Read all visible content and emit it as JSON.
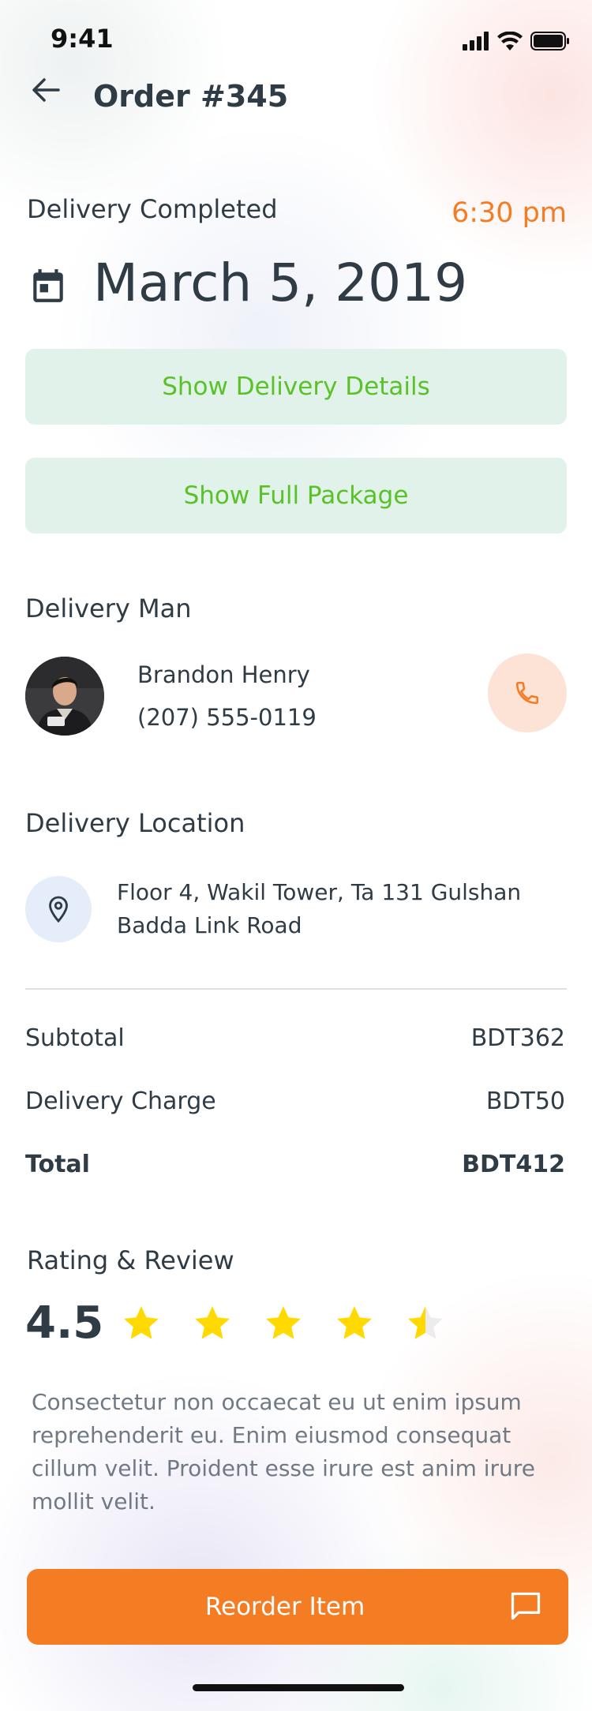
{
  "status_bar": {
    "time": "9:41"
  },
  "header": {
    "back_icon": "arrow-left-icon",
    "title": "Order #345"
  },
  "delivery": {
    "status": "Delivery Completed",
    "time": "6:30 pm",
    "date": "March 5, 2019",
    "details_button": "Show  Delivery Details",
    "package_button": "Show Full Package"
  },
  "delivery_man": {
    "section_title": "Delivery Man",
    "name": "Brandon Henry",
    "phone": "(207) 555-0119",
    "call_icon": "phone-icon"
  },
  "location": {
    "section_title": "Delivery Location",
    "address_line1": "Floor 4, Wakil Tower, Ta 131 Gulshan",
    "address_line2": "Badda Link Road",
    "icon": "location-pin-icon"
  },
  "summary": {
    "subtotal_label": "Subtotal",
    "subtotal_value": "BDT362",
    "delivery_label": "Delivery Charge",
    "delivery_value": "BDT50",
    "total_label": "Total",
    "total_value": "BDT412"
  },
  "rating": {
    "section_title": "Rating & Review",
    "value": "4.5",
    "stars": 4.5,
    "max_stars": 5,
    "review": "Consectetur non occaecat eu ut enim ipsum reprehenderit eu. Enim eiusmod consequat cillum velit. Proident esse irure est anim irure mollit velit."
  },
  "footer": {
    "reorder_label": "Reorder Item",
    "chat_icon": "chat-icon"
  },
  "colors": {
    "accent": "#f47c22",
    "green": "#5ac227",
    "green_bg": "#e0f2ea",
    "text": "#2f3b45",
    "star": "#ffd900",
    "star_empty": "#ececec"
  }
}
